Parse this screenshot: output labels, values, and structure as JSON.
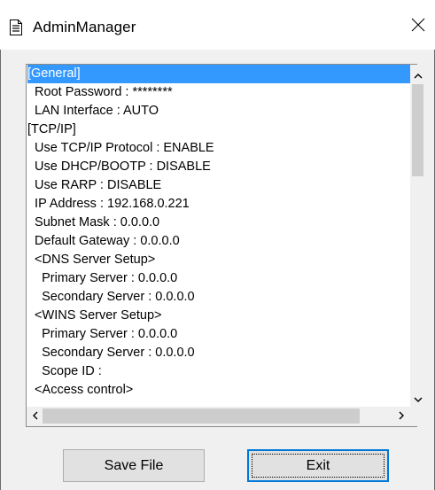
{
  "window": {
    "title": "AdminManager"
  },
  "list": {
    "selected_index": 0,
    "items": [
      "[General]",
      "  Root Password : ********",
      "  LAN Interface : AUTO",
      "[TCP/IP]",
      "  Use TCP/IP Protocol : ENABLE",
      "  Use DHCP/BOOTP : DISABLE",
      "  Use RARP : DISABLE",
      "  IP Address : 192.168.0.221",
      "  Subnet Mask : 0.0.0.0",
      "  Default Gateway : 0.0.0.0",
      "  <DNS Server Setup>",
      "    Primary Server : 0.0.0.0",
      "    Secondary Server : 0.0.0.0",
      "  <WINS Server Setup>",
      "    Primary Server : 0.0.0.0",
      "    Secondary Server : 0.0.0.0",
      "    Scope ID :",
      "  <Access control>"
    ]
  },
  "buttons": {
    "save_label": "Save File",
    "exit_label": "Exit"
  },
  "colors": {
    "selection": "#3399ff",
    "focus_border": "#0078d7"
  },
  "icons": {
    "window": "document-icon",
    "close": "close-icon",
    "scroll_up": "chevron-up-icon",
    "scroll_down": "chevron-down-icon",
    "scroll_left": "chevron-left-icon",
    "scroll_right": "chevron-right-icon"
  }
}
